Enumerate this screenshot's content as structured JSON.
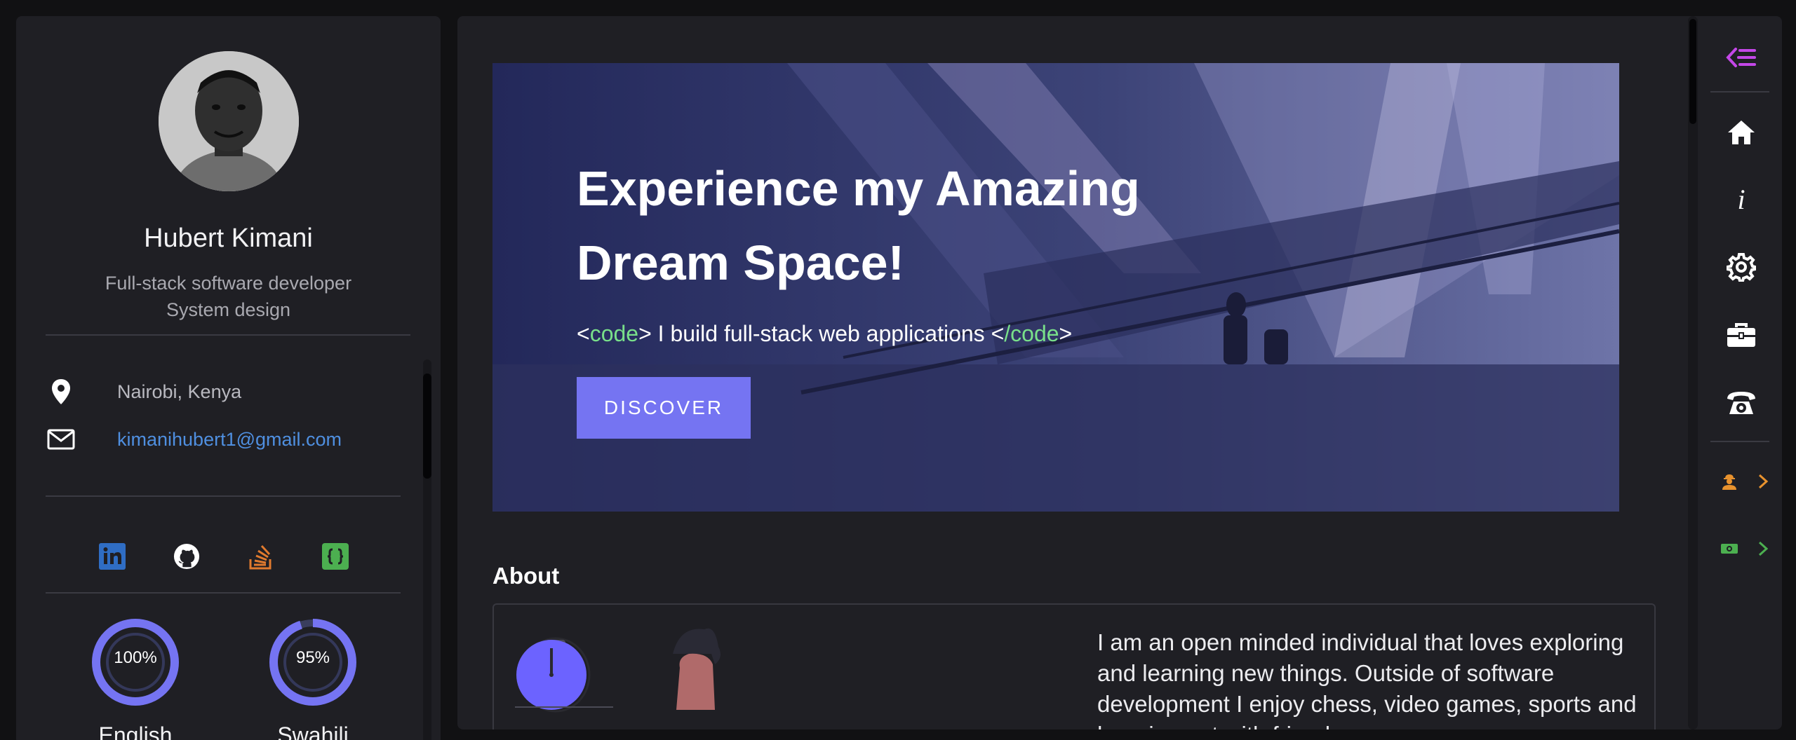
{
  "profile": {
    "name": "Hubert Kimani",
    "role_line1": "Full-stack software developer",
    "role_line2": "System design",
    "location": "Nairobi, Kenya",
    "email": "kimanihubert1@gmail.com"
  },
  "socials": [
    {
      "icon": "linkedin-icon",
      "color": "#2f6dc4"
    },
    {
      "icon": "github-icon",
      "color": "#ffffff"
    },
    {
      "icon": "stackoverflow-icon",
      "color": "#e07a2e"
    },
    {
      "icon": "code-braces-icon",
      "color": "#4caf50"
    }
  ],
  "languages": [
    {
      "label": "English",
      "percent_text": "100%",
      "value": 100
    },
    {
      "label": "Swahili",
      "percent_text": "95%",
      "value": 95
    }
  ],
  "hero": {
    "title": "Experience my Amazing Dream Space!",
    "sub_open_lt": "<",
    "sub_code_open": "code",
    "sub_middle": "> I build full-stack web applications <",
    "sub_code_close": "/code",
    "sub_end": ">",
    "button": "DISCOVER"
  },
  "about": {
    "heading": "About",
    "text": "I am an open minded individual that loves exploring and learning new things. Outside of software development I enjoy chess, video games, sports and hanging out with friends."
  },
  "nav": {
    "collapse_icon": "menu-collapse-icon",
    "items": [
      "home-icon",
      "info-icon",
      "gear-icon",
      "briefcase-icon",
      "telephone-icon"
    ],
    "tools": [
      "worker-icon",
      "money-icon"
    ]
  },
  "colors": {
    "accent": "#7574f2",
    "link": "#4f8fe0",
    "code_tag": "#79e08a",
    "collapse": "#c447e8",
    "tool1": "#e8922e",
    "tool2": "#4caf50"
  }
}
